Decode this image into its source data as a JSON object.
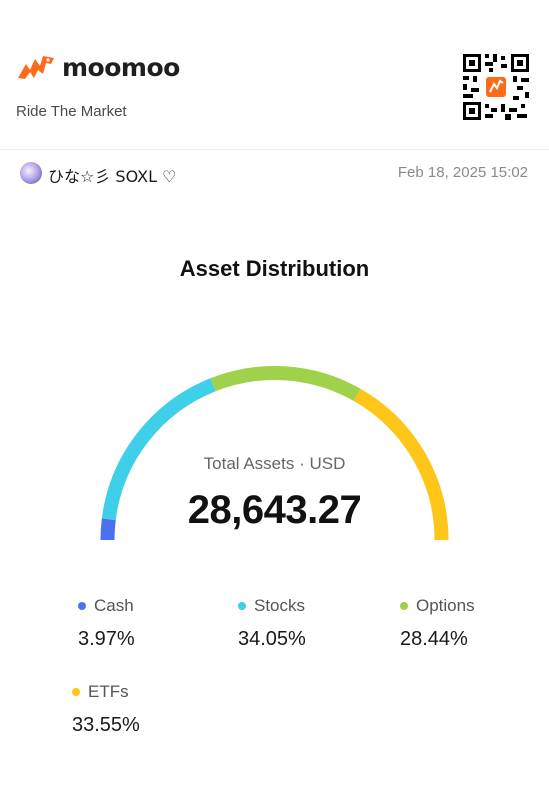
{
  "brand": {
    "name": "moomoo",
    "tagline": "Ride The Market",
    "accent": "#ff6a1a"
  },
  "user": {
    "name": "ひな☆彡 SOXL ♡",
    "timestamp": "Feb 18, 2025 15:02"
  },
  "section_title": "Asset Distribution",
  "total": {
    "label": "Total Assets · USD",
    "value": "28,643.27"
  },
  "distribution": [
    {
      "name": "Cash",
      "percent_label": "3.97%",
      "value": 3.97,
      "color": "#4a72f0"
    },
    {
      "name": "Stocks",
      "percent_label": "34.05%",
      "value": 34.05,
      "color": "#3fcfe8"
    },
    {
      "name": "Options",
      "percent_label": "28.44%",
      "value": 28.44,
      "color": "#9fd24a"
    },
    {
      "name": "ETFs",
      "percent_label": "33.55%",
      "value": 33.55,
      "color": "#ffc61a"
    }
  ]
}
